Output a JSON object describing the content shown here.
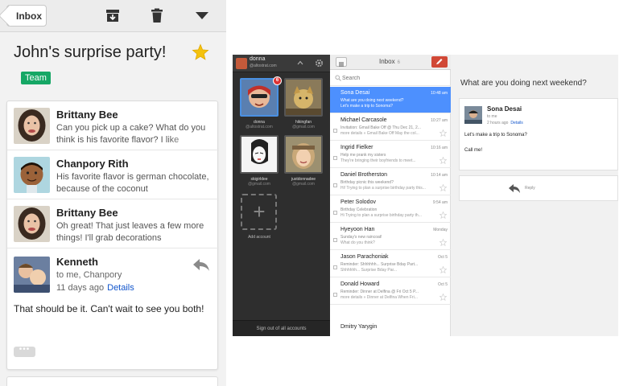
{
  "phone": {
    "toolbar": {
      "back_label": "Inbox",
      "icons": [
        "archive-icon",
        "trash-icon",
        "dropdown-icon"
      ]
    },
    "thread_title": "John's surprise party!",
    "label": "Team",
    "label_color": "#16a765",
    "messages": [
      {
        "sender": "Brittany Bee",
        "snippet": "Can you pick up a cake? What do you think is his favorite flavor? I like"
      },
      {
        "sender": "Chanpory Rith",
        "snippet": "His favorite flavor is german chocolate, because of the coconut"
      },
      {
        "sender": "Brittany Bee",
        "snippet": "Oh great! That just leaves a few more things! I'll grab decorations"
      }
    ],
    "expanded": {
      "sender": "Kenneth",
      "to": "to me, Chanpory",
      "time": "11 days ago",
      "details": "Details",
      "body": "That should be it. Can't wait to see you both!",
      "more": "•••"
    }
  },
  "tablet": {
    "account_header": {
      "name": "donna",
      "email": "@altostrat.com"
    },
    "accounts": [
      {
        "name": "donna",
        "email": "@altostrat.com",
        "badge": "6"
      },
      {
        "name": "hikingfan",
        "email": "@gmail.com"
      },
      {
        "name": "skigirldee",
        "email": "@gmail.com"
      },
      {
        "name": "justdonnadee",
        "email": "@gmail.com"
      }
    ],
    "add_account": "Add account",
    "sign_out": "Sign out of all accounts",
    "list": {
      "title": "Inbox",
      "count": "6",
      "search_placeholder": "Search",
      "rows": [
        {
          "sender": "Sona Desai",
          "time": "10:48 am",
          "subject": "What are you doing next weekend?",
          "snippet": "Let's make a trip to Sonoma?"
        },
        {
          "sender": "Michael Carcasole",
          "time": "10:27 am",
          "subject": "Invitation: Gmail Bake Off @ Thu Dec 21, 2...",
          "snippet": "more details » Gmail Bake Off May the col..."
        },
        {
          "sender": "Ingrid Fielker",
          "time": "10:16 am",
          "subject": "Help me prank my sisters",
          "snippet": "They're bringing their boyfriends to meet..."
        },
        {
          "sender": "Daniel Brotherston",
          "time": "10:14 am",
          "subject": "Birthday picnic this weekend?",
          "snippet": "Hi! Trying to plan a surprise birthday party this..."
        },
        {
          "sender": "Peter Solodov",
          "time": "9:54 am",
          "subject": "Birthday Celebration",
          "snippet": "Hi Trying to plan a surprise birthday party th..."
        },
        {
          "sender": "Hyeyoon Han",
          "time": "Monday",
          "subject": "Sunday's new raincoat!",
          "snippet": "What do you think?"
        },
        {
          "sender": "Jason Parachoniak",
          "time": "Oct 5",
          "subject": "Reminder: Shhhhhh... Surprise Bday Part...",
          "snippet": "Shhhhhh... Surprise Bday Par..."
        },
        {
          "sender": "Donald Howard",
          "time": "Oct 5",
          "subject": "Reminder: Dinner at Delfina @ Fri Oct 5 P...",
          "snippet": "more details » Dinner at Delfina When Fri..."
        },
        {
          "sender": "Dmitry Yarygin",
          "time": "",
          "subject": "",
          "snippet": ""
        }
      ]
    },
    "reading": {
      "subject": "What are you doing next weekend?",
      "sender": "Sona Desai",
      "to": "to me",
      "time": "2 hours ago",
      "details": "Details",
      "body1": "Let's make a trip to Sonoma?",
      "body2": "Call me!",
      "reply": "Reply"
    },
    "colors": {
      "selected_row": "#4d90fe",
      "compose": "#d14836",
      "badge": "#dd3333"
    }
  }
}
